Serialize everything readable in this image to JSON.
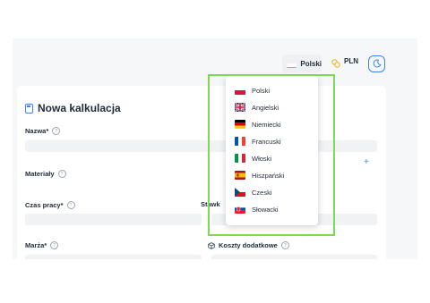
{
  "header": {
    "language_label": "Polski",
    "language_flag": "pl-flag-icon",
    "currency_label": "PLN",
    "currency_icon": "coins-icon",
    "theme_icon": "moon-icon"
  },
  "form": {
    "title": "Nowa kalkulacja",
    "fields": {
      "name_label": "Nazwa*",
      "materials_label": "Materiały",
      "work_time_label": "Czas pracy*",
      "rate_label": "Stawk",
      "margin_label": "Marża*",
      "extra_costs_label": "Koszty dodatkowe"
    },
    "add_material": "+"
  },
  "language_menu": {
    "items": [
      {
        "label": "Polski",
        "icon": "pl-flag-icon"
      },
      {
        "label": "Angielski",
        "icon": "gb-flag-icon"
      },
      {
        "label": "Niemiecki",
        "icon": "de-flag-icon"
      },
      {
        "label": "Francuski",
        "icon": "fr-flag-icon"
      },
      {
        "label": "Włoski",
        "icon": "it-flag-icon"
      },
      {
        "label": "Hiszpański",
        "icon": "es-flag-icon"
      },
      {
        "label": "Czeski",
        "icon": "cz-flag-icon"
      },
      {
        "label": "Słowacki",
        "icon": "sk-flag-icon"
      }
    ]
  },
  "colors": {
    "accent": "#3b82f6",
    "highlight": "#7ed957"
  }
}
